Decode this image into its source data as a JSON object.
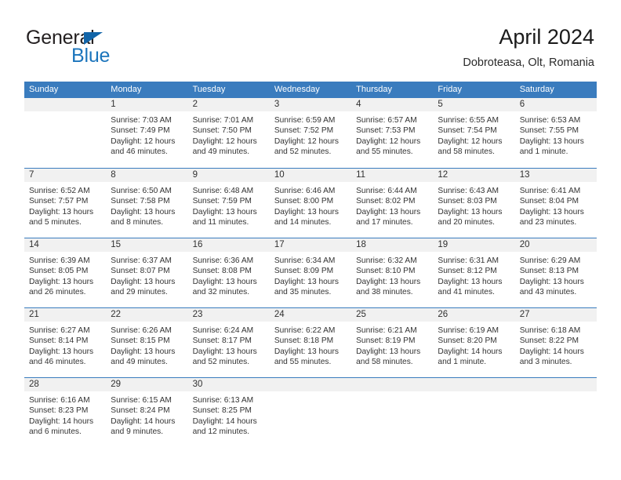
{
  "brand": {
    "word_one": "General",
    "word_two": "Blue",
    "triangle_icon": "blue-triangle-icon"
  },
  "header": {
    "title": "April 2024",
    "subtitle": "Dobroteasa, Olt, Romania"
  },
  "colors": {
    "header_blue": "#3a7cbe",
    "brand_blue": "#1c75bc",
    "daynumber_band": "#f1f1f1",
    "text": "#333333"
  },
  "calendar": {
    "day_headers": [
      "Sunday",
      "Monday",
      "Tuesday",
      "Wednesday",
      "Thursday",
      "Friday",
      "Saturday"
    ],
    "weeks": [
      [
        {
          "day": "",
          "sunrise": "",
          "sunset": "",
          "daylight_line1": "",
          "daylight_line2": ""
        },
        {
          "day": "1",
          "sunrise": "Sunrise: 7:03 AM",
          "sunset": "Sunset: 7:49 PM",
          "daylight_line1": "Daylight: 12 hours",
          "daylight_line2": "and 46 minutes."
        },
        {
          "day": "2",
          "sunrise": "Sunrise: 7:01 AM",
          "sunset": "Sunset: 7:50 PM",
          "daylight_line1": "Daylight: 12 hours",
          "daylight_line2": "and 49 minutes."
        },
        {
          "day": "3",
          "sunrise": "Sunrise: 6:59 AM",
          "sunset": "Sunset: 7:52 PM",
          "daylight_line1": "Daylight: 12 hours",
          "daylight_line2": "and 52 minutes."
        },
        {
          "day": "4",
          "sunrise": "Sunrise: 6:57 AM",
          "sunset": "Sunset: 7:53 PM",
          "daylight_line1": "Daylight: 12 hours",
          "daylight_line2": "and 55 minutes."
        },
        {
          "day": "5",
          "sunrise": "Sunrise: 6:55 AM",
          "sunset": "Sunset: 7:54 PM",
          "daylight_line1": "Daylight: 12 hours",
          "daylight_line2": "and 58 minutes."
        },
        {
          "day": "6",
          "sunrise": "Sunrise: 6:53 AM",
          "sunset": "Sunset: 7:55 PM",
          "daylight_line1": "Daylight: 13 hours",
          "daylight_line2": "and 1 minute."
        }
      ],
      [
        {
          "day": "7",
          "sunrise": "Sunrise: 6:52 AM",
          "sunset": "Sunset: 7:57 PM",
          "daylight_line1": "Daylight: 13 hours",
          "daylight_line2": "and 5 minutes."
        },
        {
          "day": "8",
          "sunrise": "Sunrise: 6:50 AM",
          "sunset": "Sunset: 7:58 PM",
          "daylight_line1": "Daylight: 13 hours",
          "daylight_line2": "and 8 minutes."
        },
        {
          "day": "9",
          "sunrise": "Sunrise: 6:48 AM",
          "sunset": "Sunset: 7:59 PM",
          "daylight_line1": "Daylight: 13 hours",
          "daylight_line2": "and 11 minutes."
        },
        {
          "day": "10",
          "sunrise": "Sunrise: 6:46 AM",
          "sunset": "Sunset: 8:00 PM",
          "daylight_line1": "Daylight: 13 hours",
          "daylight_line2": "and 14 minutes."
        },
        {
          "day": "11",
          "sunrise": "Sunrise: 6:44 AM",
          "sunset": "Sunset: 8:02 PM",
          "daylight_line1": "Daylight: 13 hours",
          "daylight_line2": "and 17 minutes."
        },
        {
          "day": "12",
          "sunrise": "Sunrise: 6:43 AM",
          "sunset": "Sunset: 8:03 PM",
          "daylight_line1": "Daylight: 13 hours",
          "daylight_line2": "and 20 minutes."
        },
        {
          "day": "13",
          "sunrise": "Sunrise: 6:41 AM",
          "sunset": "Sunset: 8:04 PM",
          "daylight_line1": "Daylight: 13 hours",
          "daylight_line2": "and 23 minutes."
        }
      ],
      [
        {
          "day": "14",
          "sunrise": "Sunrise: 6:39 AM",
          "sunset": "Sunset: 8:05 PM",
          "daylight_line1": "Daylight: 13 hours",
          "daylight_line2": "and 26 minutes."
        },
        {
          "day": "15",
          "sunrise": "Sunrise: 6:37 AM",
          "sunset": "Sunset: 8:07 PM",
          "daylight_line1": "Daylight: 13 hours",
          "daylight_line2": "and 29 minutes."
        },
        {
          "day": "16",
          "sunrise": "Sunrise: 6:36 AM",
          "sunset": "Sunset: 8:08 PM",
          "daylight_line1": "Daylight: 13 hours",
          "daylight_line2": "and 32 minutes."
        },
        {
          "day": "17",
          "sunrise": "Sunrise: 6:34 AM",
          "sunset": "Sunset: 8:09 PM",
          "daylight_line1": "Daylight: 13 hours",
          "daylight_line2": "and 35 minutes."
        },
        {
          "day": "18",
          "sunrise": "Sunrise: 6:32 AM",
          "sunset": "Sunset: 8:10 PM",
          "daylight_line1": "Daylight: 13 hours",
          "daylight_line2": "and 38 minutes."
        },
        {
          "day": "19",
          "sunrise": "Sunrise: 6:31 AM",
          "sunset": "Sunset: 8:12 PM",
          "daylight_line1": "Daylight: 13 hours",
          "daylight_line2": "and 41 minutes."
        },
        {
          "day": "20",
          "sunrise": "Sunrise: 6:29 AM",
          "sunset": "Sunset: 8:13 PM",
          "daylight_line1": "Daylight: 13 hours",
          "daylight_line2": "and 43 minutes."
        }
      ],
      [
        {
          "day": "21",
          "sunrise": "Sunrise: 6:27 AM",
          "sunset": "Sunset: 8:14 PM",
          "daylight_line1": "Daylight: 13 hours",
          "daylight_line2": "and 46 minutes."
        },
        {
          "day": "22",
          "sunrise": "Sunrise: 6:26 AM",
          "sunset": "Sunset: 8:15 PM",
          "daylight_line1": "Daylight: 13 hours",
          "daylight_line2": "and 49 minutes."
        },
        {
          "day": "23",
          "sunrise": "Sunrise: 6:24 AM",
          "sunset": "Sunset: 8:17 PM",
          "daylight_line1": "Daylight: 13 hours",
          "daylight_line2": "and 52 minutes."
        },
        {
          "day": "24",
          "sunrise": "Sunrise: 6:22 AM",
          "sunset": "Sunset: 8:18 PM",
          "daylight_line1": "Daylight: 13 hours",
          "daylight_line2": "and 55 minutes."
        },
        {
          "day": "25",
          "sunrise": "Sunrise: 6:21 AM",
          "sunset": "Sunset: 8:19 PM",
          "daylight_line1": "Daylight: 13 hours",
          "daylight_line2": "and 58 minutes."
        },
        {
          "day": "26",
          "sunrise": "Sunrise: 6:19 AM",
          "sunset": "Sunset: 8:20 PM",
          "daylight_line1": "Daylight: 14 hours",
          "daylight_line2": "and 1 minute."
        },
        {
          "day": "27",
          "sunrise": "Sunrise: 6:18 AM",
          "sunset": "Sunset: 8:22 PM",
          "daylight_line1": "Daylight: 14 hours",
          "daylight_line2": "and 3 minutes."
        }
      ],
      [
        {
          "day": "28",
          "sunrise": "Sunrise: 6:16 AM",
          "sunset": "Sunset: 8:23 PM",
          "daylight_line1": "Daylight: 14 hours",
          "daylight_line2": "and 6 minutes."
        },
        {
          "day": "29",
          "sunrise": "Sunrise: 6:15 AM",
          "sunset": "Sunset: 8:24 PM",
          "daylight_line1": "Daylight: 14 hours",
          "daylight_line2": "and 9 minutes."
        },
        {
          "day": "30",
          "sunrise": "Sunrise: 6:13 AM",
          "sunset": "Sunset: 8:25 PM",
          "daylight_line1": "Daylight: 14 hours",
          "daylight_line2": "and 12 minutes."
        },
        {
          "day": "",
          "sunrise": "",
          "sunset": "",
          "daylight_line1": "",
          "daylight_line2": ""
        },
        {
          "day": "",
          "sunrise": "",
          "sunset": "",
          "daylight_line1": "",
          "daylight_line2": ""
        },
        {
          "day": "",
          "sunrise": "",
          "sunset": "",
          "daylight_line1": "",
          "daylight_line2": ""
        },
        {
          "day": "",
          "sunrise": "",
          "sunset": "",
          "daylight_line1": "",
          "daylight_line2": ""
        }
      ]
    ]
  }
}
